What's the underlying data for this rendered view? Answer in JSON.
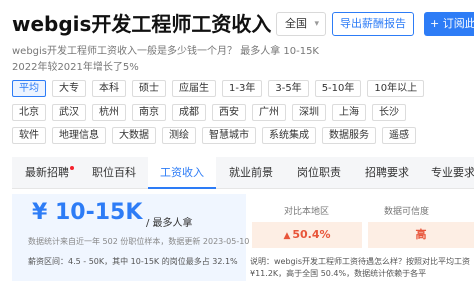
{
  "header": {
    "title": "webgis开发工程师工资收入",
    "region": "全国",
    "export_label": "导出薪酬报告",
    "subscribe_label": "+ 订阅此职"
  },
  "summary": {
    "description": "webgis开发工程师工资收入一般是多少钱一个月？ 最多人拿 10-15K",
    "growth": "2022年较2021年增长了5%"
  },
  "filters": {
    "education": [
      {
        "label": "平均",
        "active": true
      },
      {
        "label": "大专"
      },
      {
        "label": "本科"
      },
      {
        "label": "硕士"
      },
      {
        "label": "应届生"
      },
      {
        "label": "1-3年"
      },
      {
        "label": "3-5年"
      },
      {
        "label": "5-10年"
      },
      {
        "label": "10年以上"
      }
    ],
    "cities": [
      "北京",
      "武汉",
      "杭州",
      "南京",
      "成都",
      "西安",
      "广州",
      "深圳",
      "上海",
      "长沙"
    ],
    "industries": [
      "软件",
      "地理信息",
      "大数据",
      "测绘",
      "智慧城市",
      "系统集成",
      "数据服务",
      "遥感"
    ]
  },
  "tabs": [
    {
      "label": "最新招聘",
      "has_dot": true
    },
    {
      "label": "职位百科"
    },
    {
      "label": "工资收入",
      "active": true
    },
    {
      "label": "就业前景"
    },
    {
      "label": "岗位职责"
    },
    {
      "label": "招聘要求"
    },
    {
      "label": "专业要求"
    }
  ],
  "salary": {
    "value": "¥ 10-15K",
    "note": "/ 最多人拿",
    "source": "数据统计来自近一年 502 份职位样本，数据更新 2023-05-10",
    "range": "薪资区间：4.5 - 50K，其中 10-15K 的岗位最多占 32.1%"
  },
  "stats": {
    "compare_label": "对比本地区",
    "compare_value": "50.4%",
    "confidence_label": "数据可信度",
    "confidence_value": "高"
  },
  "explanation": "说明：webgis开发工程师工资待遇怎么样？按照对比平均工资¥11.2K，高于全国 50.4%，数据统计依赖于各平"
}
